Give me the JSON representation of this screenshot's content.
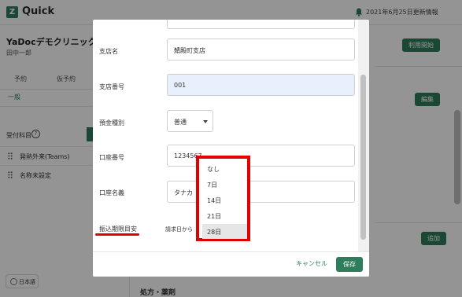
{
  "app": {
    "logo_letter": "Z",
    "name": "Quick"
  },
  "header": {
    "update_text": "2021年6月25日更新情報"
  },
  "sidebar": {
    "clinic_name": "YaDocデモクリニック",
    "user_name": "田中一郎",
    "tabs": [
      "予約",
      "仮予約"
    ],
    "sub_tab": "一般",
    "section_label": "受付科目",
    "help_glyph": "?",
    "items": [
      "発熱外来(Teams)",
      "名称未設定"
    ],
    "language": "日本語"
  },
  "right": {
    "start_button": "利用開始",
    "edit_button": "編集",
    "add_button": "追加",
    "bottom_title": "処方・薬剤"
  },
  "modal": {
    "fields": [
      {
        "label": "支店名",
        "value": "鯖殿町支店"
      },
      {
        "label": "支店番号",
        "value": "001"
      },
      {
        "label": "預金種別",
        "value": "普通"
      },
      {
        "label": "口座番号",
        "value": "1234567"
      },
      {
        "label": "口座名義",
        "value": "タナカ"
      }
    ],
    "deadline": {
      "label": "振込期限目安",
      "prefix": "請求日から"
    },
    "cancel": "キャンセル",
    "save": "保存"
  },
  "dropdown": {
    "options": [
      "なし",
      "7日",
      "14日",
      "21日",
      "28日"
    ],
    "selected": "28日"
  },
  "colors": {
    "accent": "#2e7d5b",
    "highlight": "#e00000",
    "overlay": "rgba(0,0,0,0.42)"
  }
}
